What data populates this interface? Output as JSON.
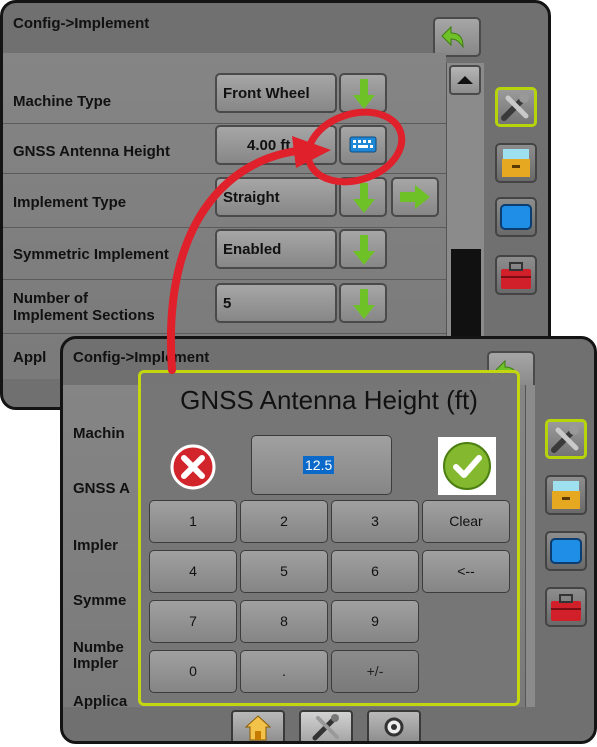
{
  "top_screen": {
    "breadcrumb": "Config->Implement",
    "rows": [
      {
        "label": "Machine Type",
        "value": "Front Wheel"
      },
      {
        "label": "GNSS Antenna Height",
        "value": "4.00 ft"
      },
      {
        "label": "Implement Type",
        "value": "Straight"
      },
      {
        "label": "Symmetric Implement",
        "value": "Enabled"
      },
      {
        "label_line1": "Number of",
        "label_line2": "Implement Sections",
        "value": "5"
      },
      {
        "label": "Appl"
      }
    ]
  },
  "bottom_screen": {
    "breadcrumb": "Config->Implement",
    "bg_labels": [
      "Machin",
      "GNSS A",
      "Impler",
      "Symme",
      "Numbe",
      "Impler",
      "Applica"
    ]
  },
  "keypad_dialog": {
    "title": "GNSS Antenna Height (ft)",
    "value": "12.5",
    "keys": [
      [
        "1",
        "2",
        "3",
        "Clear"
      ],
      [
        "4",
        "5",
        "6",
        "<--"
      ],
      [
        "7",
        "8",
        "9"
      ],
      [
        "0",
        ".",
        "+/-"
      ]
    ]
  },
  "colors": {
    "accent": "#c4d60f",
    "callout": "#e0202a",
    "arrow_green": "#6fc128",
    "cancel_red": "#d1252b",
    "confirm_green": "#84b82f",
    "selection_blue": "#0a69c9"
  },
  "icons": {
    "back": "back-arrow-icon",
    "dropdown": "green-down-arrow-icon",
    "next": "green-right-arrow-icon",
    "keyboard": "keyboard-icon",
    "tools": "tools-icon",
    "cabinet": "file-cabinet-icon",
    "display": "display-icon",
    "toolbox": "toolbox-icon",
    "home": "home-icon",
    "settings": "gauge-icon"
  }
}
